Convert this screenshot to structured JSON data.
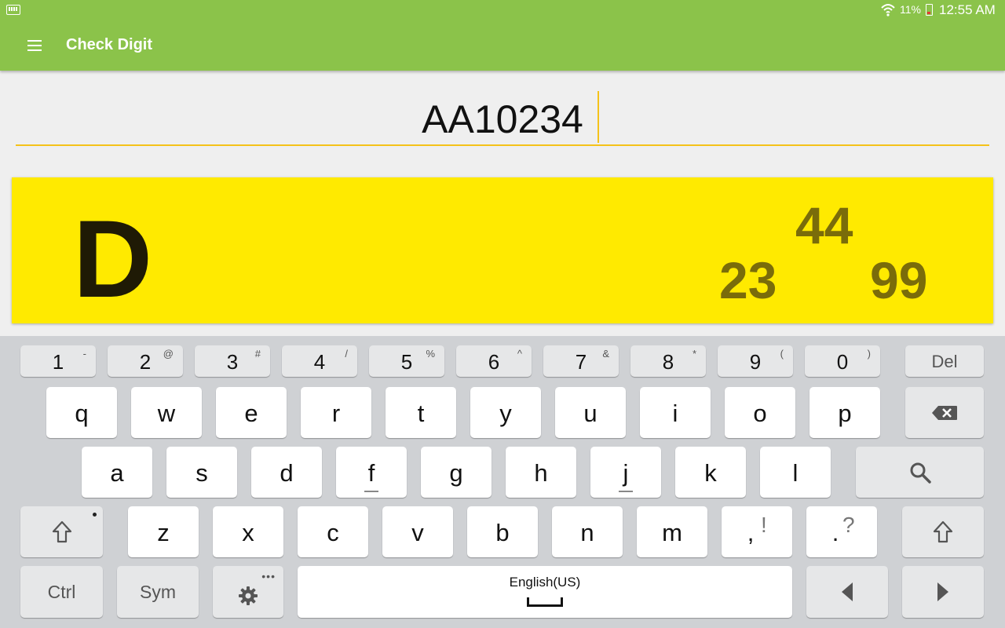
{
  "status_bar": {
    "battery_percent": "11%",
    "time": "12:55 AM",
    "icons": [
      "keyboard-icon",
      "wifi-icon",
      "battery-icon"
    ]
  },
  "app_bar": {
    "title": "Check Digit",
    "menu_icon": "hamburger-menu-icon"
  },
  "input": {
    "value": "AA10234",
    "underline_color": "#f5c219"
  },
  "result": {
    "letter": "D",
    "top_number": "44",
    "left_number": "23",
    "right_number": "99",
    "background": "#ffea00"
  },
  "keyboard": {
    "number_row": [
      {
        "key": "1",
        "hint": "-"
      },
      {
        "key": "2",
        "hint": "@"
      },
      {
        "key": "3",
        "hint": "#"
      },
      {
        "key": "4",
        "hint": "/"
      },
      {
        "key": "5",
        "hint": "%"
      },
      {
        "key": "6",
        "hint": "^"
      },
      {
        "key": "7",
        "hint": "&"
      },
      {
        "key": "8",
        "hint": "*"
      },
      {
        "key": "9",
        "hint": "("
      },
      {
        "key": "0",
        "hint": ")"
      }
    ],
    "del_label": "Del",
    "row_q": [
      "q",
      "w",
      "e",
      "r",
      "t",
      "y",
      "u",
      "i",
      "o",
      "p"
    ],
    "row_a": [
      "a",
      "s",
      "d",
      "f",
      "g",
      "h",
      "j",
      "k",
      "l"
    ],
    "row_z": [
      "z",
      "x",
      "c",
      "v",
      "b",
      "n",
      "m"
    ],
    "comma": {
      "key": ",",
      "hint": "!"
    },
    "period": {
      "key": ".",
      "hint": "?"
    },
    "ctrl_label": "Ctrl",
    "sym_label": "Sym",
    "settings_dots": "•••",
    "space_label": "English(US)",
    "icons": [
      "backspace-icon",
      "search-icon",
      "shift-icon",
      "settings-gear-icon",
      "arrow-left-icon",
      "arrow-right-icon"
    ]
  },
  "colors": {
    "app_bar": "#8bc34a",
    "accent": "#f5c219",
    "keyboard_bg": "#cfd1d4"
  }
}
